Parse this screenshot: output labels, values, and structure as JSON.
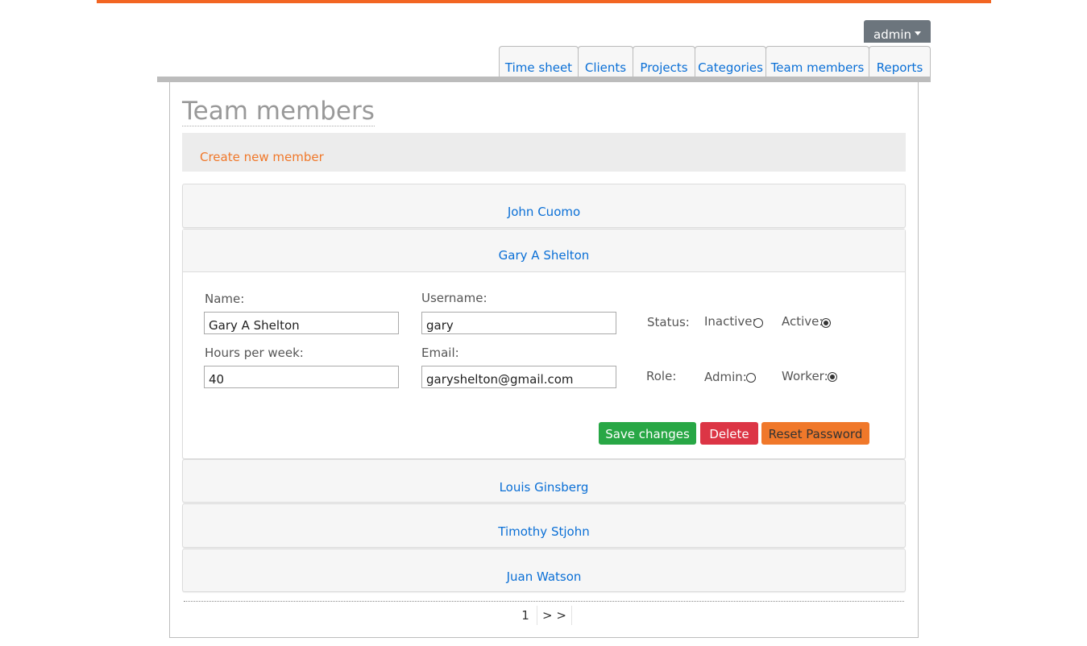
{
  "header": {
    "user_menu_label": "admin"
  },
  "nav": {
    "tabs": [
      {
        "label": "Time sheet"
      },
      {
        "label": "Clients"
      },
      {
        "label": "Projects"
      },
      {
        "label": "Categories"
      },
      {
        "label": "Team members"
      },
      {
        "label": "Reports"
      }
    ]
  },
  "page": {
    "title": "Team members",
    "create_link": "Create new member"
  },
  "members": [
    {
      "name": "John Cuomo"
    },
    {
      "name": "Gary A Shelton"
    },
    {
      "name": "Louis Ginsberg"
    },
    {
      "name": "Timothy Stjohn"
    },
    {
      "name": "Juan Watson"
    }
  ],
  "form": {
    "name_label": "Name:",
    "name_value": "Gary A Shelton",
    "username_label": "Username:",
    "username_value": "gary",
    "hours_label": "Hours per week:",
    "hours_value": "40",
    "email_label": "Email:",
    "email_value": "garyshelton@gmail.com",
    "status_label": "Status:",
    "status_inactive_label": "Inactive:",
    "status_active_label": "Active:",
    "status_selected": "Active",
    "role_label": "Role:",
    "role_admin_label": "Admin:",
    "role_worker_label": "Worker:",
    "role_selected": "Worker",
    "save_label": "Save changes",
    "delete_label": "Delete",
    "reset_label": "Reset Password"
  },
  "pagination": {
    "current_page": "1",
    "next_label": "> >"
  },
  "colors": {
    "accent_orange": "#f26522",
    "link_blue": "#0a6fd6",
    "save_green": "#28a745",
    "delete_red": "#dc3545",
    "reset_orange": "#f0782a"
  }
}
